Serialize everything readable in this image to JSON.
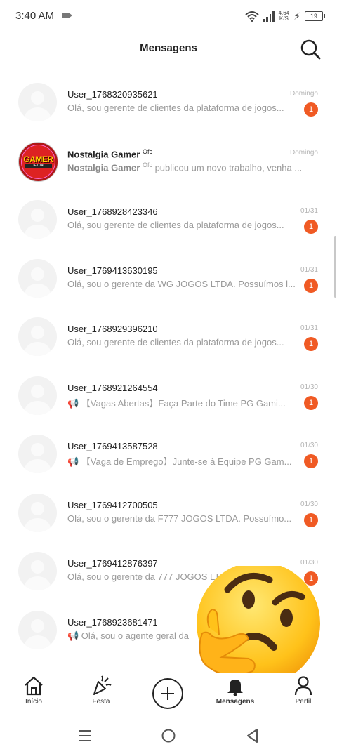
{
  "status": {
    "time": "3:40 AM",
    "speed_value": "4,64",
    "speed_unit": "K/S",
    "battery": "19"
  },
  "header": {
    "title": "Mensagens"
  },
  "conversations": [
    {
      "name": "User_1768320935621",
      "sup": "",
      "preview": "Olá, sou gerente de clientes da plataforma de jogos...",
      "preview_bold": "",
      "date": "Domingo",
      "badge": "1"
    },
    {
      "name": "Nostalgia Gamer",
      "sup": "Ofc",
      "preview": " publicou um novo trabalho, venha ...",
      "preview_bold": "Nostalgia Gamer",
      "preview_sup": "Ofc",
      "date": "Domingo",
      "badge": ""
    },
    {
      "name": "User_1768928423346",
      "sup": "",
      "preview": "Olá, sou gerente de clientes da plataforma de jogos...",
      "preview_bold": "",
      "date": "01/31",
      "badge": "1"
    },
    {
      "name": "User_1769413630195",
      "sup": "",
      "preview": "Olá, sou o gerente da WG JOGOS LTDA. Possuímos l...",
      "preview_bold": "",
      "date": "01/31",
      "badge": "1"
    },
    {
      "name": "User_1768929396210",
      "sup": "",
      "preview": "Olá, sou gerente de clientes da plataforma de jogos...",
      "preview_bold": "",
      "date": "01/31",
      "badge": "1"
    },
    {
      "name": "User_1768921264554",
      "sup": "",
      "preview": "📢 【Vagas Abertas】Faça Parte do Time PG Gami...",
      "preview_bold": "",
      "date": "01/30",
      "badge": "1"
    },
    {
      "name": "User_1769413587528",
      "sup": "",
      "preview": "📢 【Vaga de Emprego】Junte-se à Equipe PG Gam...",
      "preview_bold": "",
      "date": "01/30",
      "badge": "1"
    },
    {
      "name": "User_1769412700505",
      "sup": "",
      "preview": "Olá, sou o gerente da F777 JOGOS LTDA. Possuímo...",
      "preview_bold": "",
      "date": "01/30",
      "badge": "1"
    },
    {
      "name": "User_1769412876397",
      "sup": "",
      "preview": "Olá, sou o gerente da 777 JOGOS LTDA. Possuímos...",
      "preview_bold": "",
      "date": "01/30",
      "badge": "1"
    },
    {
      "name": "User_1768923681471",
      "sup": "",
      "preview": "📢 Olá, sou o agente geral da",
      "preview_bold": "",
      "date": "",
      "badge": ""
    }
  ],
  "tabs": [
    {
      "label": "Início",
      "icon": "home-icon"
    },
    {
      "label": "Festa",
      "icon": "party-popper-icon"
    },
    {
      "label": "",
      "icon": "add-icon"
    },
    {
      "label": "Mensagens",
      "icon": "bell-icon",
      "active": true
    },
    {
      "label": "Perfil",
      "icon": "person-icon"
    }
  ],
  "colors": {
    "badge": "#f05a24",
    "text_primary": "#222222",
    "text_secondary": "#9a9a9a",
    "date": "#b5b5b5"
  },
  "logo": {
    "text": "GAMER",
    "sub": "OFICIAL"
  }
}
